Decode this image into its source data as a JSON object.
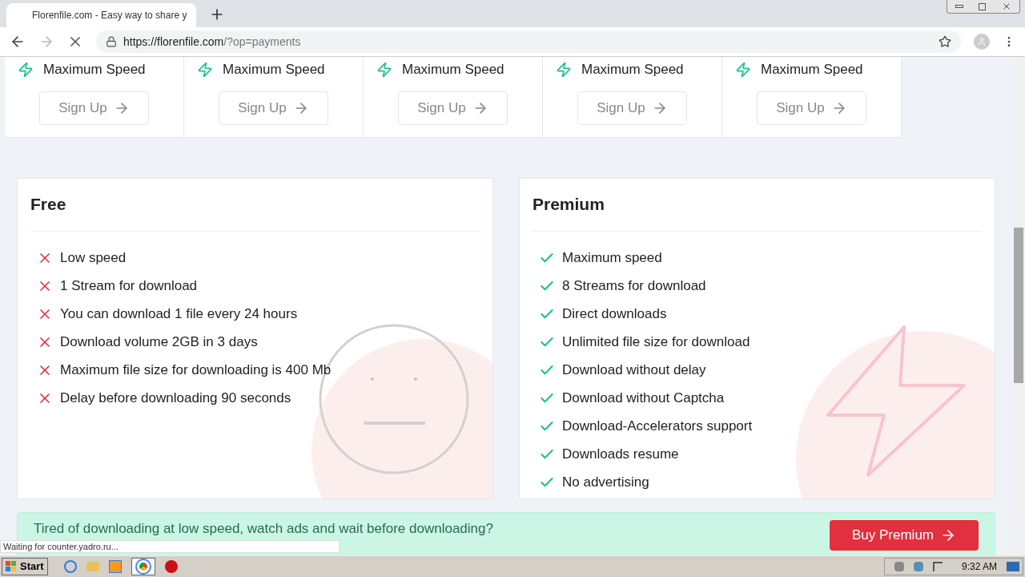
{
  "browser": {
    "tab": {
      "title": "Florenfile.com - Easy way to share y"
    },
    "address": {
      "host": "https://florenfile.com",
      "path": "/?op=payments"
    }
  },
  "plans_row": [
    {
      "feature": "Maximum Speed",
      "button": "Sign Up"
    },
    {
      "feature": "Maximum Speed",
      "button": "Sign Up"
    },
    {
      "feature": "Maximum Speed",
      "button": "Sign Up"
    },
    {
      "feature": "Maximum Speed",
      "button": "Sign Up"
    },
    {
      "feature": "Maximum Speed",
      "button": "Sign Up"
    }
  ],
  "comparison": [
    {
      "title": "Free",
      "kind": "cross",
      "items": [
        "Low speed",
        "1 Stream for download",
        "You can download 1 file every 24 hours",
        "Download volume 2GB in 3 days",
        "Maximum file size for downloading is 400 Mb",
        "Delay before downloading 90 seconds"
      ]
    },
    {
      "title": "Premium",
      "kind": "check",
      "items": [
        "Maximum speed",
        "8 Streams for download",
        "Direct downloads",
        "Unlimited file size for download",
        "Download without delay",
        "Download without Captcha",
        "Download-Accelerators support",
        "Downloads resume",
        "No advertising"
      ]
    }
  ],
  "banner": {
    "text": "Tired of downloading at low speed, watch ads and wait before downloading?",
    "button": "Buy Premium"
  },
  "status_bubble": "Waiting for counter.yadro.ru...",
  "taskbar": {
    "start": "Start",
    "clock": "9:32 AM"
  }
}
